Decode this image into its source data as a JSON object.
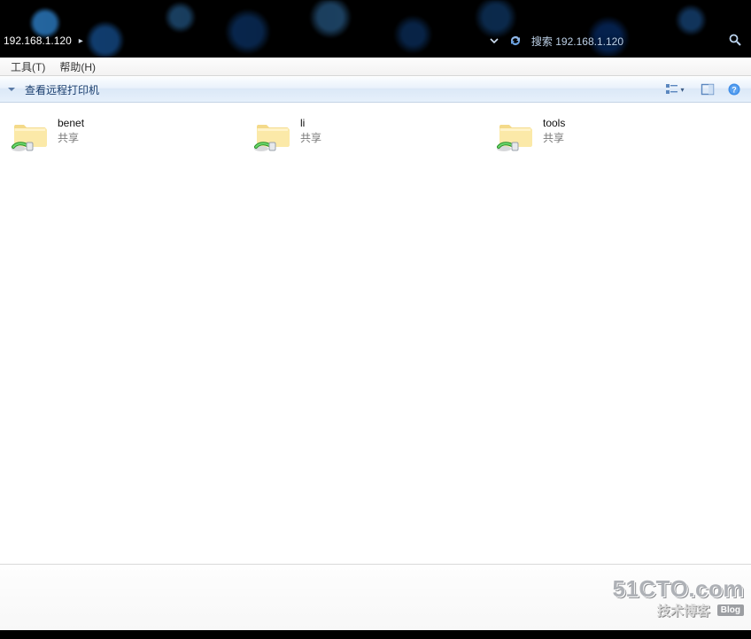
{
  "address": {
    "path_text": "192.168.1.120",
    "breadcrumb_arrow": "▸"
  },
  "search": {
    "placeholder": "搜索 192.168.1.120"
  },
  "menu": {
    "tools": "工具(T)",
    "help": "帮助(H)"
  },
  "toolbar": {
    "organize_label": "查看远程打印机"
  },
  "items": [
    {
      "name": "benet",
      "sub": "共享"
    },
    {
      "name": "li",
      "sub": "共享"
    },
    {
      "name": "tools",
      "sub": "共享"
    }
  ],
  "watermark": {
    "main": "51CTO.com",
    "cn": "技术博客",
    "tag": "Blog"
  }
}
